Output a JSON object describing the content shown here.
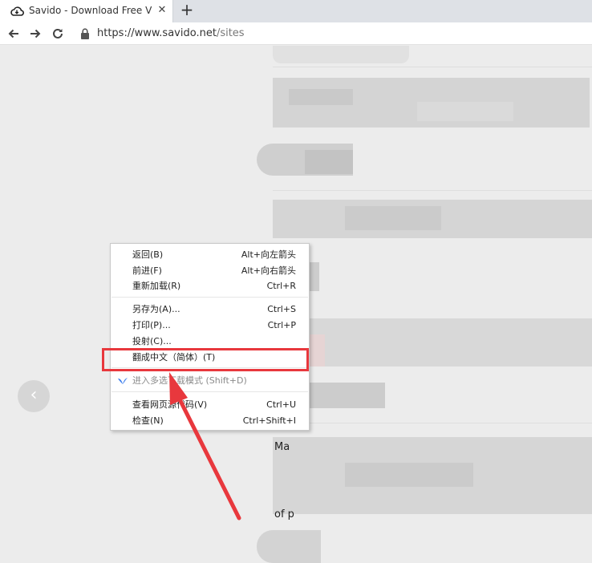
{
  "browser": {
    "tab_title": "Savido - Download Free Videos",
    "tab_close": "✕",
    "new_tab": "+",
    "url_host": "https://www.savido.net",
    "url_path": "/sites"
  },
  "page": {
    "visible_text": [
      {
        "id": "t1",
        "text": "Ma"
      },
      {
        "id": "t2",
        "text": "of p"
      }
    ]
  },
  "context_menu": {
    "items": [
      {
        "label": "返回(B)",
        "shortcut": "Alt+向左箭头"
      },
      {
        "label": "前进(F)",
        "shortcut": "Alt+向右箭头"
      },
      {
        "label": "重新加载(R)",
        "shortcut": "Ctrl+R"
      },
      {
        "label": "另存为(A)...",
        "shortcut": "Ctrl+S"
      },
      {
        "label": "打印(P)...",
        "shortcut": "Ctrl+P"
      },
      {
        "label": "投射(C)...",
        "shortcut": ""
      },
      {
        "label": "翻成中文（简体）(T)",
        "shortcut": ""
      },
      {
        "label": "进入多选下载模式 (Shift+D)",
        "shortcut": "",
        "icon": "bird-icon",
        "disabled": true
      },
      {
        "label": "查看网页源代码(V)",
        "shortcut": "Ctrl+U"
      },
      {
        "label": "检查(N)",
        "shortcut": "Ctrl+Shift+I"
      }
    ]
  },
  "colors": {
    "highlight": "#e8383d",
    "page_background": "#ececec",
    "tab_strip": "#dee1e6",
    "extension_icon": "#3b7dee"
  },
  "icons": [
    "cloud-favicon-icon",
    "close-icon",
    "plus-icon",
    "back-arrow-icon",
    "forward-arrow-icon",
    "reload-icon",
    "lock-icon",
    "chevron-left-icon",
    "bird-icon"
  ]
}
